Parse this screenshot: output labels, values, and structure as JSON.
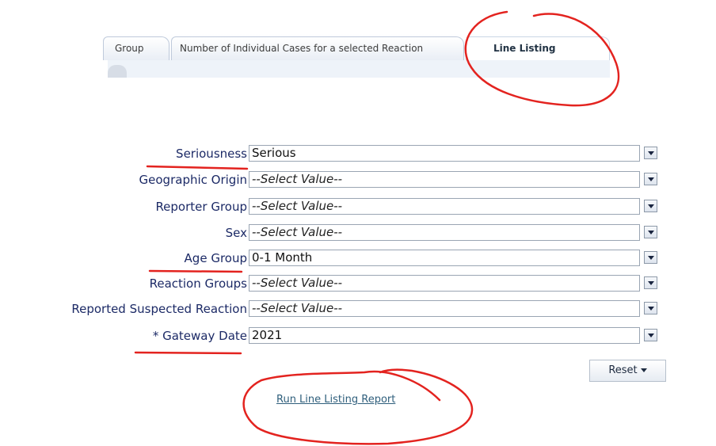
{
  "tabs": [
    {
      "label": "Group",
      "active": false
    },
    {
      "label": "Number of Individual Cases for a selected Reaction",
      "active": false
    },
    {
      "label": "Line Listing",
      "active": true
    }
  ],
  "form": {
    "fields": [
      {
        "label": "Seriousness",
        "value": "Serious",
        "placeholder": false
      },
      {
        "label": "Geographic Origin",
        "value": "--Select Value--",
        "placeholder": true
      },
      {
        "label": "Reporter Group",
        "value": "--Select Value--",
        "placeholder": true
      },
      {
        "label": "Sex",
        "value": "--Select Value--",
        "placeholder": true
      },
      {
        "label": "Age Group",
        "value": "0-1 Month",
        "placeholder": false
      },
      {
        "label": "Reaction Groups",
        "value": "--Select Value--",
        "placeholder": true
      },
      {
        "label": "Reported Suspected Reaction",
        "value": "--Select Value--",
        "placeholder": true
      },
      {
        "label": "* Gateway Date",
        "value": "2021",
        "placeholder": false
      }
    ]
  },
  "actions": {
    "reset_label": "Reset",
    "run_link_label": "Run Line Listing Report"
  },
  "annotations": {
    "color": "#e3231f"
  }
}
